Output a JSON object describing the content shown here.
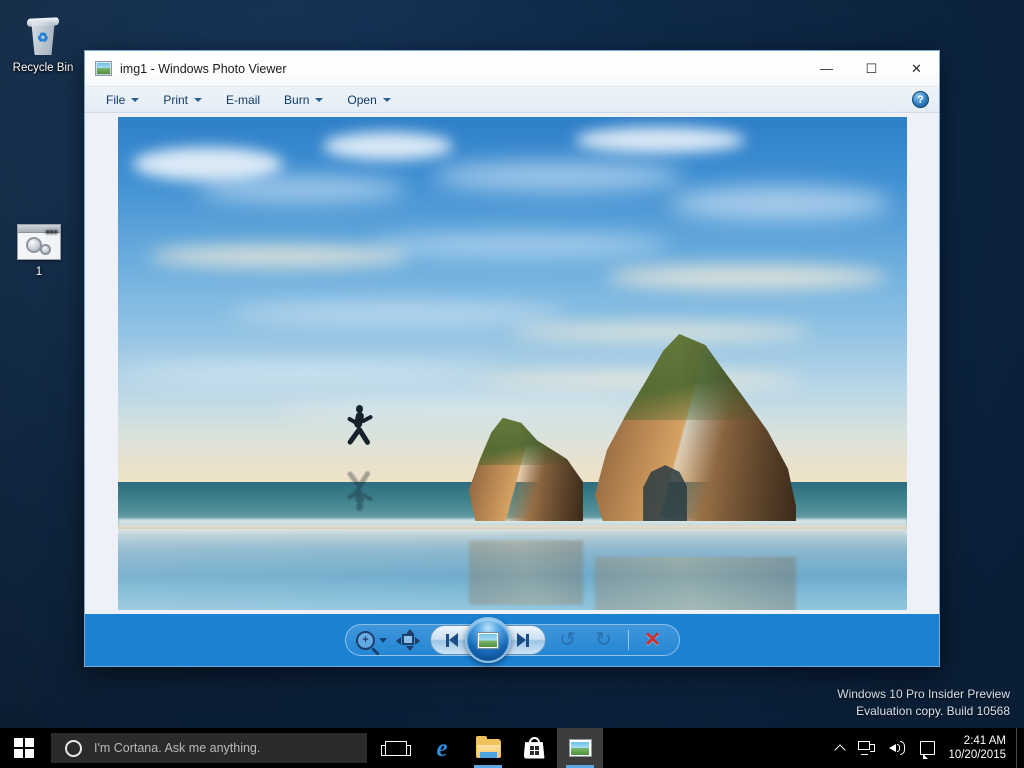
{
  "desktop": {
    "icons": [
      {
        "name": "recycle-bin",
        "label": "Recycle Bin"
      },
      {
        "name": "app-shortcut",
        "label": "1"
      }
    ],
    "watermark": {
      "line1": "Windows 10 Pro Insider Preview",
      "line2": "Evaluation copy. Build 10568"
    },
    "background_color": "#0c2340"
  },
  "viewer": {
    "title": "img1 - Windows Photo Viewer",
    "title_icon": "photo-icon",
    "window_controls": {
      "minimize": "—",
      "maximize": "☐",
      "close": "✕"
    },
    "menu": [
      {
        "label": "File",
        "has_dropdown": true
      },
      {
        "label": "Print",
        "has_dropdown": true
      },
      {
        "label": "E-mail",
        "has_dropdown": false
      },
      {
        "label": "Burn",
        "has_dropdown": true
      },
      {
        "label": "Open",
        "has_dropdown": true
      }
    ],
    "help_label": "?",
    "toolbar": {
      "zoom_label": "Zoom",
      "fit_label": "Fit to window",
      "previous_label": "Previous",
      "slideshow_label": "Play slide show",
      "next_label": "Next",
      "rotate_ccw_label": "Rotate counterclockwise",
      "rotate_cw_label": "Rotate clockwise",
      "delete_label": "Delete",
      "rotate_ccw_glyph": "↺",
      "rotate_cw_glyph": "↻",
      "delete_glyph": "✕",
      "accent_color": "#1b82d4"
    },
    "image": {
      "alt": "Wharariki Beach with Archway Islands and a running person reflected on wet sand"
    },
    "canvas_color": "#eef2f8"
  },
  "taskbar": {
    "start_label": "Start",
    "search": {
      "placeholder": "I'm Cortana. Ask me anything.",
      "icon": "cortana-circle-icon"
    },
    "items": [
      {
        "name": "task-view",
        "label": "Task View",
        "active": false,
        "running": false
      },
      {
        "name": "microsoft-edge",
        "label": "Microsoft Edge",
        "active": false,
        "running": false
      },
      {
        "name": "file-explorer",
        "label": "File Explorer",
        "active": false,
        "running": true
      },
      {
        "name": "store",
        "label": "Store",
        "active": false,
        "running": false
      },
      {
        "name": "photo-viewer",
        "label": "Windows Photo Viewer",
        "active": true,
        "running": true
      }
    ],
    "tray": {
      "show_hidden_label": "Show hidden icons",
      "network_label": "Network",
      "volume_label": "Speakers",
      "action_center_label": "Action Center",
      "time": "2:41 AM",
      "date": "10/20/2015"
    }
  }
}
